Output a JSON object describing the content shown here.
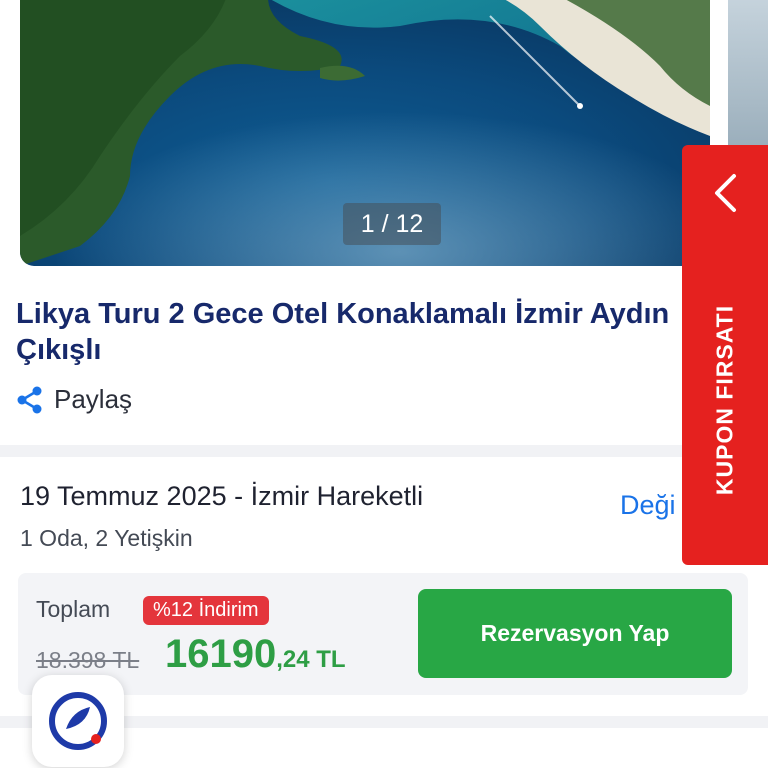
{
  "gallery": {
    "counter": "1 / 12"
  },
  "tour": {
    "title": "Likya Turu 2 Gece Otel Konaklamalı İzmir Aydın Çıkışlı"
  },
  "share": {
    "label": "Paylaş",
    "icon": "share-icon"
  },
  "booking": {
    "date_line": "19 Temmuz 2025 - İzmir Hareketli",
    "rooms_line": "1 Oda, 2 Yetişkin",
    "change_label": "Deği"
  },
  "price": {
    "total_label": "Toplam",
    "discount_badge": "%12 İndirim",
    "old_price": "18.398 TL",
    "new_price_main": "16190",
    "new_price_fraction": ",24 TL",
    "reserve_label": "Rezervasyon Yap"
  },
  "coupon": {
    "label": "KUPON FIRSATI",
    "icon": "chevron-left-icon"
  },
  "colors": {
    "brand_navy": "#17296b",
    "accent_blue": "#1a73e8",
    "coupon_red": "#e5211f",
    "discount_red": "#e4353c",
    "success_green": "#28a745"
  }
}
